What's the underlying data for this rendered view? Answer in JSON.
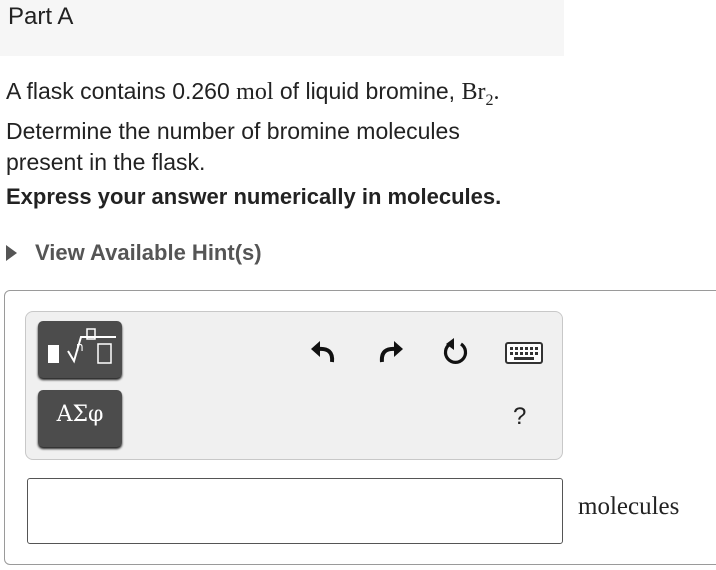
{
  "part": {
    "title": "Part A"
  },
  "question": {
    "line1_prefix": "A flask contains 0.260",
    "line1_unit": "mol",
    "line1_mid": "of liquid bromine,",
    "formula_base": "Br",
    "formula_sub": "2",
    "formula_end": ".",
    "line2": "Determine the number of bromine molecules",
    "line3": "present in the flask."
  },
  "instruction": "Express your answer numerically in molecules.",
  "hint": {
    "label": "View Available Hint(s)"
  },
  "toolbar": {
    "symbols_label": "ΑΣφ",
    "help_label": "?",
    "icons": [
      "templates-icon",
      "undo-icon",
      "redo-icon",
      "reset-icon",
      "keyboard-icon"
    ]
  },
  "answer": {
    "value": "",
    "unit": "molecules"
  }
}
